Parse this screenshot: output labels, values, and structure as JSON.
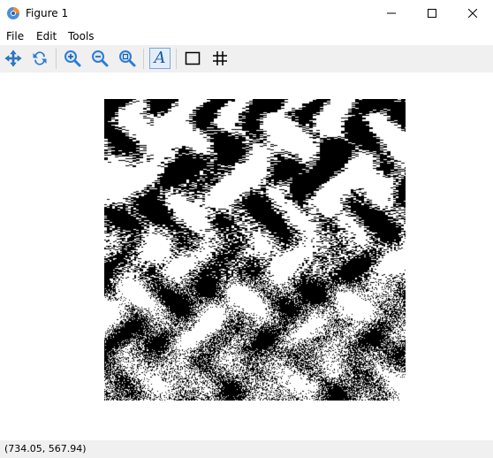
{
  "window": {
    "title": "Figure 1"
  },
  "menu": {
    "items": [
      "File",
      "Edit",
      "Tools"
    ]
  },
  "toolbar": {
    "tools": [
      {
        "name": "pan-icon",
        "tooltip": ""
      },
      {
        "name": "reset-icon",
        "tooltip": ""
      },
      {
        "name": "zoom-in-icon",
        "tooltip": ""
      },
      {
        "name": "zoom-out-icon",
        "tooltip": ""
      },
      {
        "name": "zoom-fit-icon",
        "tooltip": ""
      },
      {
        "name": "text-icon",
        "tooltip": ""
      },
      {
        "name": "box-icon",
        "tooltip": ""
      },
      {
        "name": "grid-icon",
        "tooltip": ""
      }
    ],
    "text_tool_glyph": "A"
  },
  "figure": {
    "image": "binary black-and-white noise pattern",
    "colors": {
      "foreground": "#000000",
      "background": "#ffffff"
    }
  },
  "status": {
    "coordinates": "(734.05, 567.94)"
  },
  "colors": {
    "toolbar_bg": "#f0f0f0",
    "status_bg": "#f0f0f0",
    "accent_blue": "#2d7dd2"
  }
}
